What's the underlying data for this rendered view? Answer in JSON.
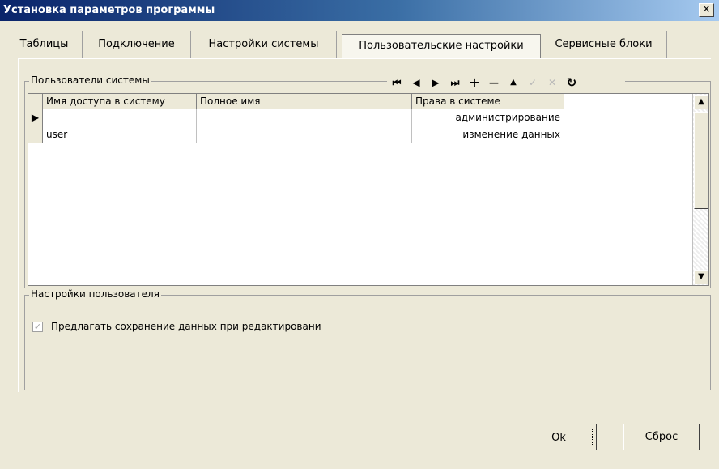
{
  "window": {
    "title": "Установка параметров программы",
    "close_glyph": "×"
  },
  "tabs": [
    {
      "label": "Таблицы"
    },
    {
      "label": "Подключение"
    },
    {
      "label": "Настройки системы"
    },
    {
      "label": "Пользовательские настройки",
      "active": true
    },
    {
      "label": "Сервисные блоки"
    }
  ],
  "users_group": {
    "label": "Пользователи системы",
    "navigator": [
      {
        "icon": "first-record-icon",
        "glyph": "⏮",
        "enabled": true
      },
      {
        "icon": "prior-record-icon",
        "glyph": "◀",
        "enabled": true
      },
      {
        "icon": "next-record-icon",
        "glyph": "▶",
        "enabled": true
      },
      {
        "icon": "last-record-icon",
        "glyph": "⏭",
        "enabled": true
      },
      {
        "icon": "insert-record-icon",
        "glyph": "+",
        "enabled": true
      },
      {
        "icon": "delete-record-icon",
        "glyph": "—",
        "enabled": true
      },
      {
        "icon": "edit-record-icon",
        "glyph": "▲",
        "enabled": true
      },
      {
        "icon": "post-record-icon",
        "glyph": "✓",
        "enabled": false
      },
      {
        "icon": "cancel-record-icon",
        "glyph": "✕",
        "enabled": false
      },
      {
        "icon": "refresh-icon",
        "glyph": "↻",
        "enabled": true
      }
    ],
    "columns": [
      "Имя доступа в систему",
      "Полное имя",
      "Права в системе"
    ],
    "rows": [
      {
        "login": "",
        "full_name": "",
        "rights": "администрирование",
        "current": true
      },
      {
        "login": "user",
        "full_name": "",
        "rights": "изменение данных",
        "current": false
      }
    ],
    "row_indicator_glyph": "▶",
    "scroll_up_glyph": "▲",
    "scroll_down_glyph": "▼"
  },
  "user_settings_group": {
    "label": "Настройки пользователя",
    "checkbox": {
      "label": "Предлагать сохранение данных при редактировани",
      "checked": true,
      "disabled": true,
      "glyph": "✓"
    }
  },
  "buttons": {
    "ok": "Ok",
    "reset": "Сброс"
  }
}
